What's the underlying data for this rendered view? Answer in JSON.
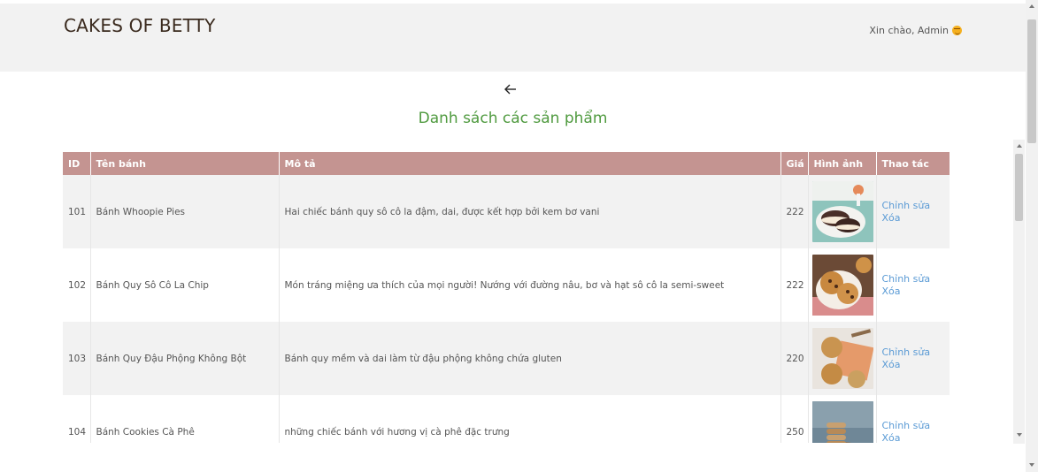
{
  "header": {
    "brand": "CAKES OF BETTY",
    "greeting": "Xin chào, Admin"
  },
  "main": {
    "title": "Danh sách các sản phẩm"
  },
  "table": {
    "columns": [
      "ID",
      "Tên bánh",
      "Mô tả",
      "Giá",
      "Hình ảnh",
      "Thao tác"
    ],
    "rows": [
      {
        "id": "101",
        "name": "Bánh Whoopie Pies",
        "desc": "Hai chiếc bánh quy sô cô la đậm, dai, được kết hợp bởi kem bơ vani",
        "price": "222",
        "edit": "Chỉnh sửa",
        "del": "Xóa"
      },
      {
        "id": "102",
        "name": "Bánh Quy Sô Cô La Chip",
        "desc": "Món tráng miệng ưa thích của mọi người! Nướng với đường nâu, bơ và hạt sô cô la semi-sweet",
        "price": "222",
        "edit": "Chỉnh sửa",
        "del": "Xóa"
      },
      {
        "id": "103",
        "name": "Bánh Quy Đậu Phộng Không Bột",
        "desc": "Bánh quy mềm và dai làm từ đậu phộng không chứa gluten",
        "price": "220",
        "edit": "Chỉnh sửa",
        "del": "Xóa"
      },
      {
        "id": "104",
        "name": "Bánh Cookies Cà Phê",
        "desc": "những chiếc bánh với hương vị cà phê đặc trưng",
        "price": "250",
        "edit": "Chỉnh sửa",
        "del": "Xóa"
      }
    ]
  },
  "colors": {
    "header_bg": "#f2f2f2",
    "table_header": "#c49491",
    "title_green": "#4f9a3f",
    "link_blue": "#5b9bd5"
  },
  "icons": {
    "back": "arrow-left-icon",
    "greeting": "smile-emoji-icon"
  }
}
